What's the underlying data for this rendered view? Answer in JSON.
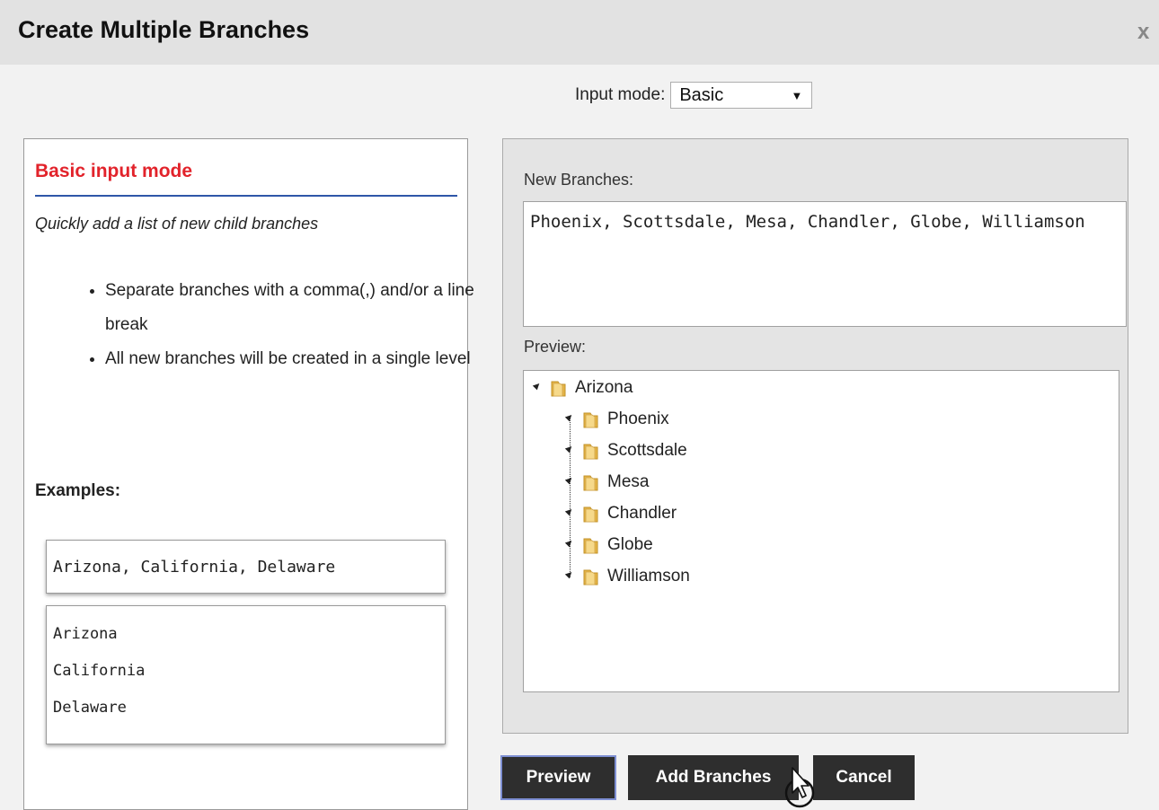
{
  "dialog": {
    "title": "Create Multiple Branches",
    "close_label": "x"
  },
  "input_mode": {
    "label": "Input mode:",
    "selected": "Basic"
  },
  "help": {
    "title": "Basic input mode",
    "description": "Quickly add a list of new child branches",
    "bullets": [
      "Separate branches with a comma(,) and/or a line break",
      "All new branches will be created in a single level"
    ],
    "examples_label": "Examples:",
    "example_inline": "Arizona, California, Delaware",
    "example_lines": [
      "Arizona",
      "California",
      "Delaware"
    ]
  },
  "editor": {
    "new_label": "New Branches:",
    "new_value": "Phoenix, Scottsdale, Mesa, Chandler, Globe, Williamson",
    "preview_label": "Preview:",
    "tree": {
      "root": "Arizona",
      "children": [
        "Phoenix",
        "Scottsdale",
        "Mesa",
        "Chandler",
        "Globe",
        "Williamson"
      ]
    }
  },
  "buttons": {
    "preview": "Preview",
    "add": "Add Branches",
    "cancel": "Cancel"
  },
  "colors": {
    "accent_red": "#e2232b",
    "divider_blue": "#2e56a8",
    "button_bg": "#2e2e2e"
  }
}
